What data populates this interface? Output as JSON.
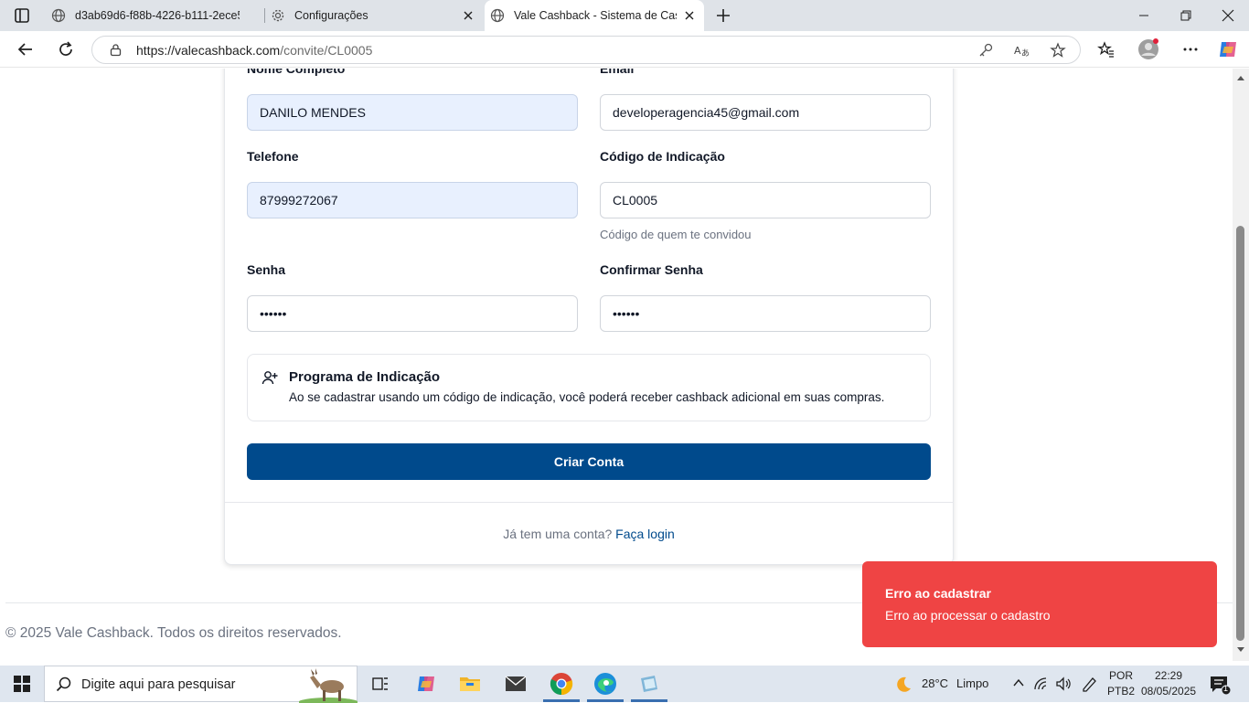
{
  "browser": {
    "tabs": [
      {
        "title": "d3ab69d6-f88b-4226-b111-2ece5",
        "active": false
      },
      {
        "title": "Configurações",
        "active": false
      },
      {
        "title": "Vale Cashback - Sistema de Cashb",
        "active": true
      }
    ],
    "url_host": "https://valecashback.com",
    "url_path": "/convite/CL0005"
  },
  "form": {
    "nome_label": "Nome Completo",
    "nome_value": "DANILO MENDES",
    "email_label": "Email",
    "email_value": "developeragencia45@gmail.com",
    "telefone_label": "Telefone",
    "telefone_value": "87999272067",
    "codigo_label": "Código de Indicação",
    "codigo_value": "CL0005",
    "codigo_hint": "Código de quem te convidou",
    "senha_label": "Senha",
    "senha_value": "••••••",
    "confirmar_label": "Confirmar Senha",
    "confirmar_value": "••••••",
    "info_title": "Programa de Indicação",
    "info_desc": "Ao se cadastrar usando um código de indicação, você poderá receber cashback adicional em suas compras.",
    "submit_label": "Criar Conta",
    "login_prompt": "Já tem uma conta?",
    "login_link": "Faça login"
  },
  "footer": {
    "text": "© 2025 Vale Cashback. Todos os direitos reservados."
  },
  "toast": {
    "title": "Erro ao cadastrar",
    "message": "Erro ao processar o cadastro"
  },
  "taskbar": {
    "search_placeholder": "Digite aqui para pesquisar",
    "weather_temp": "28°C",
    "weather_desc": "Limpo",
    "lang_top": "POR",
    "lang_bottom": "PTB2",
    "time": "22:29",
    "date": "08/05/2025",
    "notifications": "1"
  },
  "colors": {
    "primary": "#004a8c",
    "toast_bg": "#ef4444",
    "autofill_bg": "#e8f0fe"
  }
}
